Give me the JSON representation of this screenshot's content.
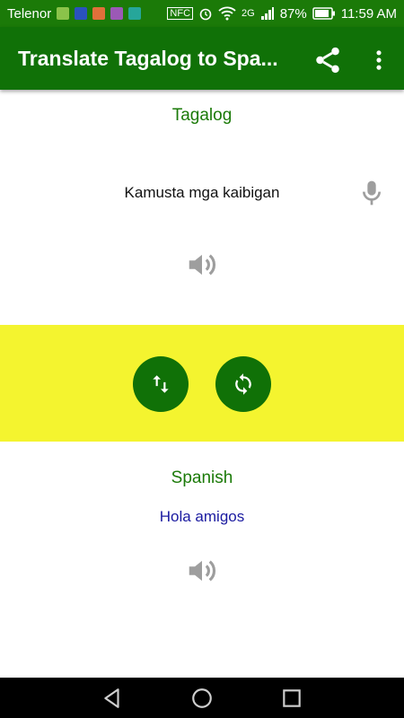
{
  "status_bar": {
    "carrier": "Telenor",
    "network": "2G",
    "battery": "87%",
    "time": "11:59 AM",
    "icons": [
      "broom-icon",
      "app-icon",
      "app-icon",
      "app-icon",
      "download-icon",
      "nfc-icon",
      "alarm-icon",
      "wifi-icon",
      "signal-icon",
      "battery-icon"
    ]
  },
  "app_bar": {
    "title": "Translate Tagalog to Spa...",
    "actions": [
      "share-icon",
      "more-vert-icon"
    ]
  },
  "source": {
    "language": "Tagalog",
    "text": "Kamusta mga kaibigan"
  },
  "controls": {
    "buttons": [
      "swap-languages-icon",
      "refresh-translate-icon"
    ]
  },
  "target": {
    "language": "Spanish",
    "text": "Hola amigos"
  },
  "colors": {
    "status_bar": "#1b7a08",
    "app_bar": "#107107",
    "band": "#f4f42f",
    "language_label": "#1b7a08",
    "translated_text": "#1a1aa0"
  }
}
